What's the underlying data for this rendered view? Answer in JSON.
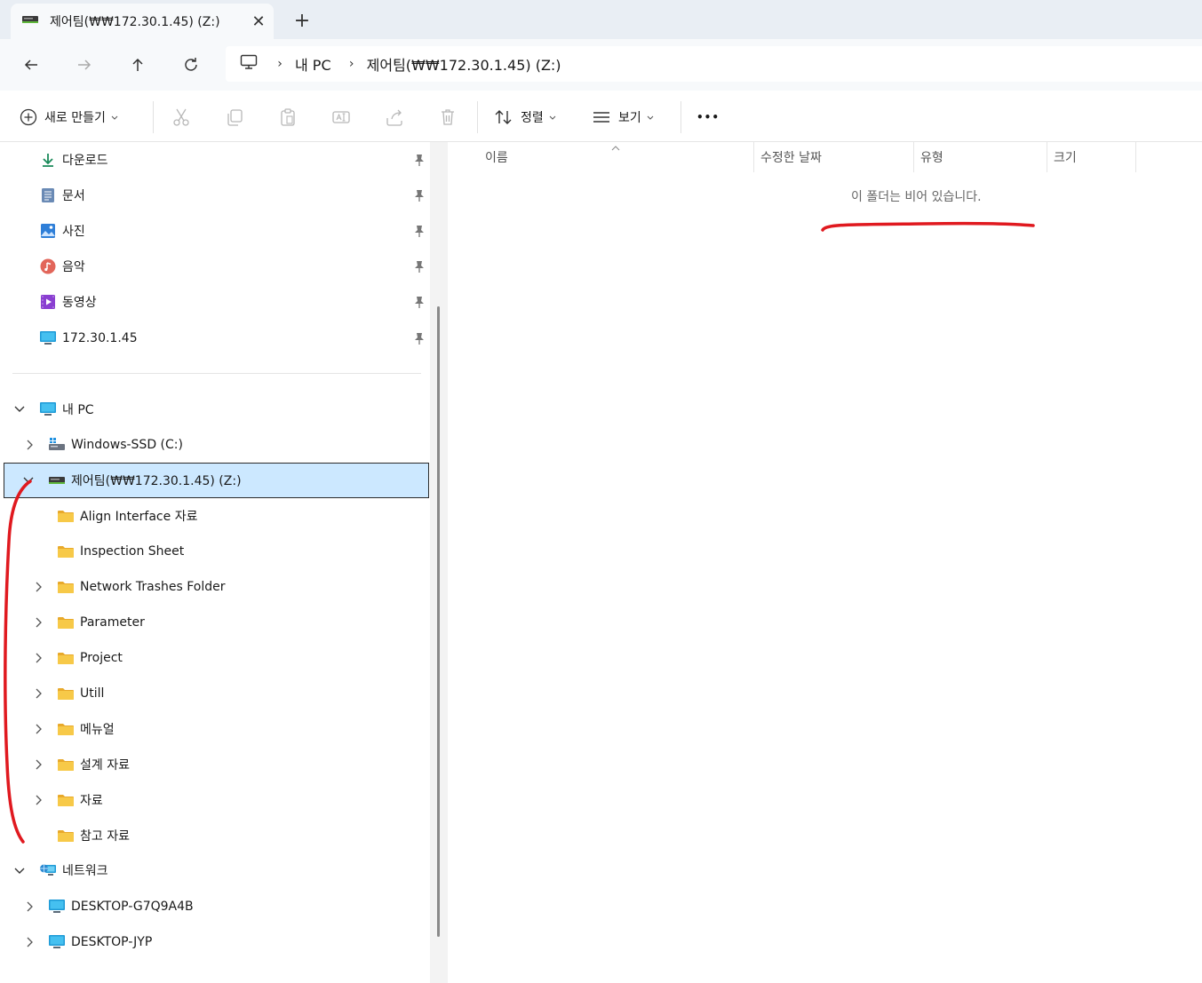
{
  "tab": {
    "title": "제어팀(₩₩172.30.1.45) (Z:)",
    "close_glyph": "✕",
    "new_tab_glyph": "+"
  },
  "address": {
    "crumbs": [
      "내 PC",
      "제어팀(₩₩172.30.1.45) (Z:)"
    ],
    "sep": "›"
  },
  "toolbar": {
    "new_label": "새로 만들기",
    "sort_label": "정렬",
    "view_label": "보기",
    "more_glyph": "•••",
    "dropdown_glyph": "⌄"
  },
  "quick_access": [
    {
      "label": "다운로드",
      "icon": "download-icon"
    },
    {
      "label": "문서",
      "icon": "document-icon"
    },
    {
      "label": "사진",
      "icon": "pictures-icon"
    },
    {
      "label": "음악",
      "icon": "music-icon"
    },
    {
      "label": "동영상",
      "icon": "videos-icon"
    },
    {
      "label": "172.30.1.45",
      "icon": "monitor-icon"
    }
  ],
  "tree": {
    "this_pc": "내 PC",
    "c_drive": "Windows-SSD (C:)",
    "z_drive": "제어팀(₩₩172.30.1.45) (Z:)",
    "folders": [
      {
        "label": "Align Interface 자료",
        "has_children": false
      },
      {
        "label": "Inspection Sheet",
        "has_children": false
      },
      {
        "label": "Network Trashes Folder",
        "has_children": true
      },
      {
        "label": "Parameter",
        "has_children": true
      },
      {
        "label": "Project",
        "has_children": true
      },
      {
        "label": "Utill",
        "has_children": true
      },
      {
        "label": "메뉴얼",
        "has_children": true
      },
      {
        "label": "설계 자료",
        "has_children": true
      },
      {
        "label": "자료",
        "has_children": true
      },
      {
        "label": "참고 자료",
        "has_children": false
      }
    ],
    "network": "네트워크",
    "network_items": [
      "DESKTOP-G7Q9A4B",
      "DESKTOP-JYP"
    ]
  },
  "columns": {
    "name": "이름",
    "modified": "수정한 날짜",
    "type": "유형",
    "size": "크기"
  },
  "empty_message": "이 폴더는 비어 있습니다.",
  "colors": {
    "selection_bg": "#cce8ff",
    "annotation_red": "#e0191f",
    "folder_yellow": "#f7c948",
    "accent_blue": "#0078d4"
  }
}
